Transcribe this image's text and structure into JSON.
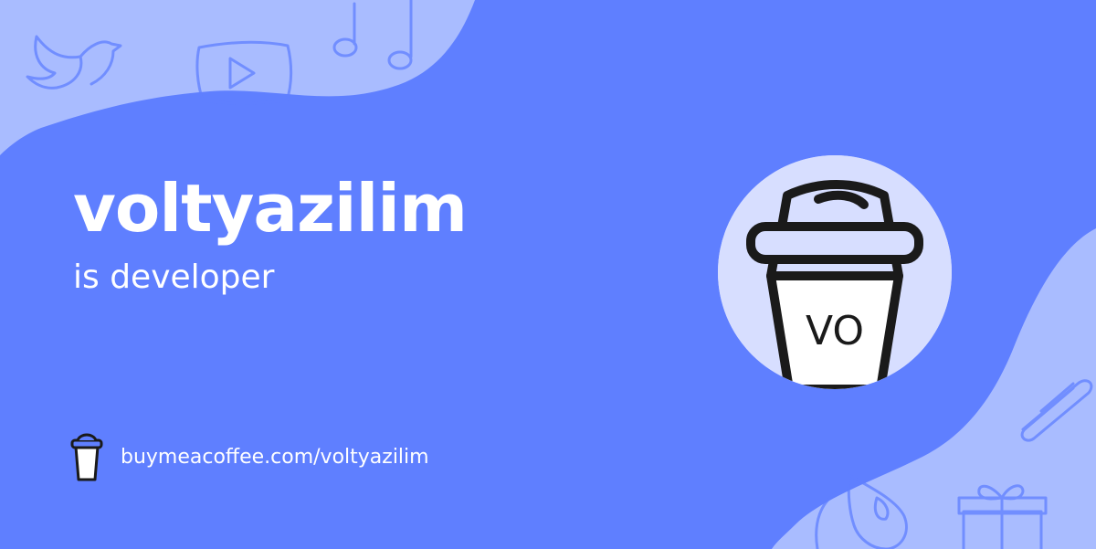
{
  "profile": {
    "name": "voltyazilim",
    "tagline": "is developer",
    "avatar_initials": "VO"
  },
  "footer": {
    "url": "buymeacoffee.com/voltyazilim",
    "icon": "coffee-cup-icon"
  },
  "colors": {
    "background": "#5f7fff",
    "wave": "#a9bcff",
    "avatar_bg": "#d7deff",
    "text": "#ffffff"
  },
  "decorations": [
    "bird-icon",
    "play-icon",
    "music-note-icon",
    "heart-icon",
    "gift-icon",
    "clip-icon"
  ]
}
